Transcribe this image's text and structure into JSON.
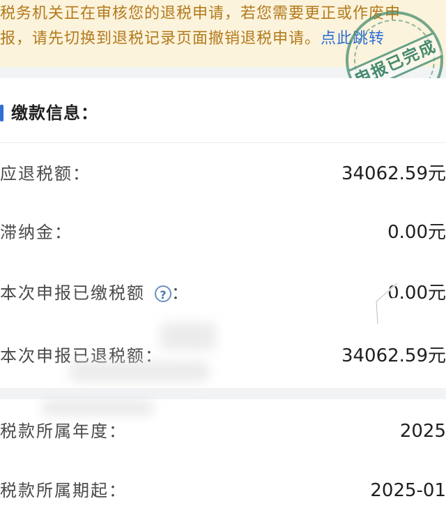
{
  "notice": {
    "line1": "税务机关正在审核您的退税申请，若您需要更正或作废申",
    "line2_prefix": "报，请先切换到退税记录页面撤销退税申请。",
    "jump_link": "点此跳转"
  },
  "stamp": {
    "text": "申报已完成"
  },
  "payment_info": {
    "title": "缴款信息：",
    "rows": [
      {
        "label": "应退税额：",
        "value": "34062.59元"
      },
      {
        "label": "滞纳金：",
        "value": "0.00元"
      },
      {
        "label": "本次申报已缴税额",
        "label_suffix": "：",
        "value": "0.00元"
      },
      {
        "label": "本次申报已退税额：",
        "value": "34062.59元"
      }
    ]
  },
  "period_info": {
    "rows": [
      {
        "label": "税款所属年度：",
        "value": "2025"
      },
      {
        "label": "税款所属期起：",
        "value": "2025-01"
      }
    ]
  },
  "icons": {
    "help": "?"
  },
  "colors": {
    "notice_text": "#b37a1c",
    "link": "#2f6fd6",
    "accent_bar": "#2f6fd6",
    "stamp": "#468c6e"
  }
}
